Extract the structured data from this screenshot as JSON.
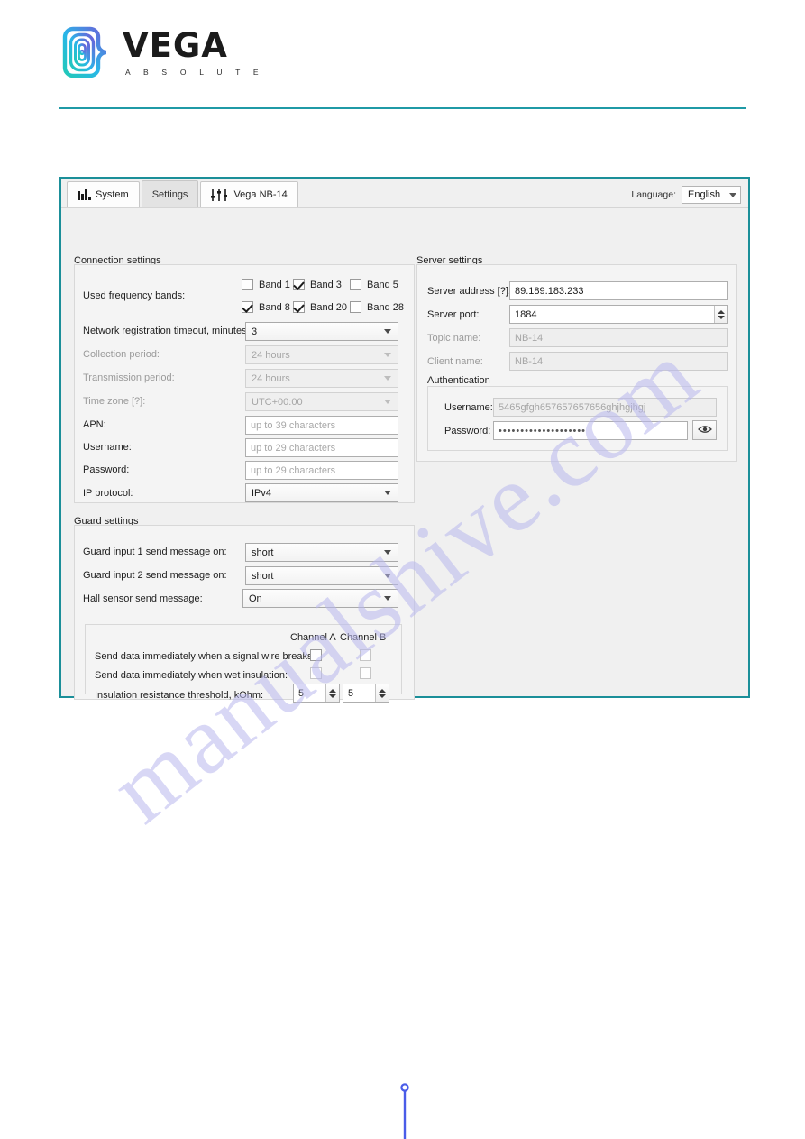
{
  "brand": {
    "name": "VEGA",
    "subtitle": "A B S O L U T E",
    "logo_icon": "vega-spiral-logo",
    "accent_color": "#1f9aa6"
  },
  "watermark": {
    "text": "manualshive.com"
  },
  "app": {
    "border_color": "#1b8f99",
    "tabs": [
      {
        "label": "System",
        "icon": "bar-chart-icon",
        "active": false
      },
      {
        "label": "Settings",
        "icon": "",
        "active": true
      },
      {
        "label": "Vega NB-14",
        "icon": "sliders-icon",
        "active": false
      }
    ],
    "language": {
      "label": "Language:",
      "value": "English"
    }
  },
  "connection": {
    "title": "Connection settings",
    "bands_label": "Used frequency bands:",
    "bands": [
      {
        "label": "Band 1",
        "checked": false
      },
      {
        "label": "Band 3",
        "checked": true
      },
      {
        "label": "Band 5",
        "checked": false
      },
      {
        "label": "Band 8",
        "checked": true
      },
      {
        "label": "Band 20",
        "checked": true
      },
      {
        "label": "Band 28",
        "checked": false
      }
    ],
    "rows": [
      {
        "label": "Network registration timeout, minutes:",
        "value": "3",
        "type": "dropdown",
        "disabled": false
      },
      {
        "label": "Collection period:",
        "value": "24 hours",
        "type": "dropdown",
        "disabled": true
      },
      {
        "label": "Transmission period:",
        "value": "24 hours",
        "type": "dropdown",
        "disabled": true
      },
      {
        "label": "Time zone [?]:",
        "value": "UTC+00:00",
        "type": "dropdown",
        "disabled": true
      },
      {
        "label": "APN:",
        "value": "",
        "placeholder": "up to 39 characters",
        "type": "text",
        "disabled": false
      },
      {
        "label": "Username:",
        "value": "",
        "placeholder": "up to 29 characters",
        "type": "text",
        "disabled": false
      },
      {
        "label": "Password:",
        "value": "",
        "placeholder": "up to 29 characters",
        "type": "text",
        "disabled": false
      },
      {
        "label": "IP protocol:",
        "value": "IPv4",
        "type": "dropdown",
        "disabled": false
      }
    ]
  },
  "server": {
    "title": "Server settings",
    "address": {
      "label": "Server address [?]:",
      "value": "89.189.183.233"
    },
    "port": {
      "label": "Server port:",
      "value": "1884"
    },
    "topic": {
      "label": "Topic name:",
      "value": "NB-14",
      "disabled": true
    },
    "client": {
      "label": "Client name:",
      "value": "NB-14",
      "disabled": true
    },
    "auth": {
      "title": "Authentication",
      "username": {
        "label": "Username:",
        "value": "5465gfgh657657657656ghjhgjhgj"
      },
      "password": {
        "label": "Password:",
        "value": "••••••••••••••••••••",
        "reveal_icon": "eye-icon"
      }
    }
  },
  "guard": {
    "title": "Guard settings",
    "rows": [
      {
        "label": "Guard input 1 send message on:",
        "value": "short"
      },
      {
        "label": "Guard input 2 send message on:",
        "value": "short"
      },
      {
        "label": "Hall sensor send message:",
        "value": "On"
      }
    ],
    "channels": {
      "headers": [
        "Channel A",
        "Channel B"
      ],
      "options": [
        {
          "label": "Send data immediately when a signal wire breaks:",
          "a_checked": false,
          "b_checked": false
        },
        {
          "label": "Send data immediately when wet insulation:",
          "a_checked": false,
          "b_checked": false
        }
      ],
      "threshold": {
        "label": "Insulation resistance threshold, kOhm:",
        "a_value": "5",
        "b_value": "5"
      }
    }
  }
}
